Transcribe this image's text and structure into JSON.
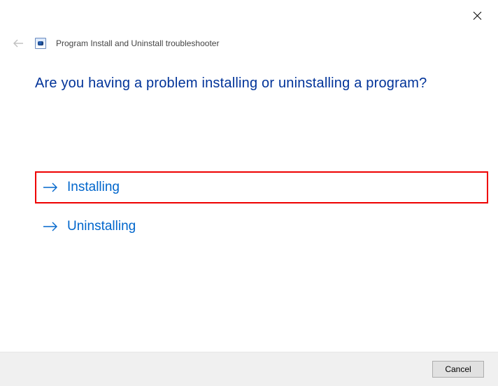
{
  "window": {
    "title": "Program Install and Uninstall troubleshooter"
  },
  "main": {
    "heading": "Are you having a problem installing or uninstalling a program?",
    "options": {
      "installing": "Installing",
      "uninstalling": "Uninstalling"
    }
  },
  "footer": {
    "cancel": "Cancel"
  }
}
